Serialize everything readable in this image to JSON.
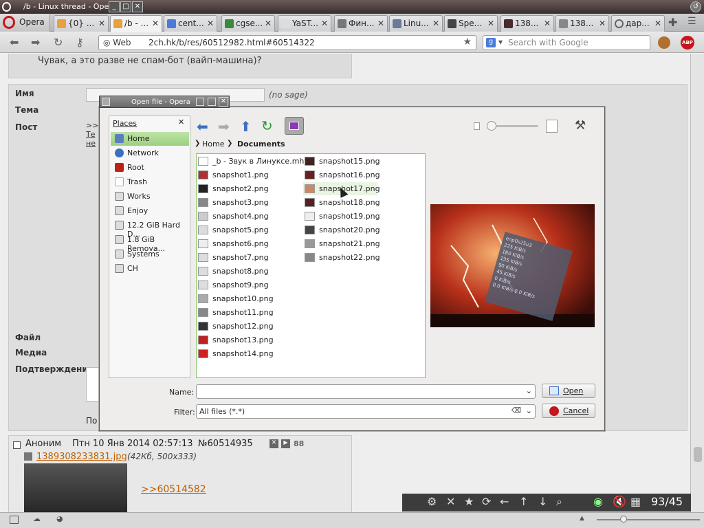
{
  "window": {
    "title": "/b - Linux thread - Opera"
  },
  "tabs": [
    {
      "label": "Opera"
    },
    {
      "label": "{0} ..."
    },
    {
      "label": "/b - ..."
    },
    {
      "label": "cent..."
    },
    {
      "label": "cgse..."
    },
    {
      "label": "YaST..."
    },
    {
      "label": "Фин..."
    },
    {
      "label": "Linu..."
    },
    {
      "label": "Spe..."
    },
    {
      "label": "138..."
    },
    {
      "label": "138..."
    },
    {
      "label": "дар..."
    }
  ],
  "nav": {
    "web_label": "Web",
    "url": "2ch.hk/b/res/60512982.html#60514322",
    "search_placeholder": "Search with Google",
    "abp": "ABP"
  },
  "page": {
    "quote_text": "Чувак, а это разве не спам-бот (вайп-машина)?",
    "form": {
      "name_label": "Имя",
      "nosage": "(no sage)",
      "subject_label": "Тема",
      "post_label": "Пост",
      "file_label": "Файл",
      "media_label": "Медиа",
      "confirm_label": "Подтверждение",
      "post_prefix": ">>",
      "post_fragment1": "Те",
      "post_fragment2": "не",
      "po_label": "По"
    },
    "reply": {
      "author": "Аноним",
      "date": "Птн 10 Янв 2014 02:57:13",
      "number": "№60514935",
      "count": "88",
      "file_link": "1389308233831.jpg",
      "file_meta": "(42Кб, 500x333)",
      "ref_link": ">>60514582"
    }
  },
  "image_toolbar": {
    "counter": "93/45"
  },
  "dialog": {
    "title": "Open file - Opera",
    "places_title": "Places",
    "places": [
      {
        "label": "Home",
        "icon": "home-icon"
      },
      {
        "label": "Network",
        "icon": "network-icon"
      },
      {
        "label": "Root",
        "icon": "root-icon"
      },
      {
        "label": "Trash",
        "icon": "trash-icon"
      },
      {
        "label": "Works",
        "icon": "drive-icon"
      },
      {
        "label": "Enjoy",
        "icon": "drive-icon"
      },
      {
        "label": "12.2 GiB Hard D...",
        "icon": "harddisk-icon"
      },
      {
        "label": "1.8 GiB Remova...",
        "icon": "removable-icon"
      },
      {
        "label": "Systems",
        "icon": "drive-icon"
      },
      {
        "label": "CH",
        "icon": "drive-icon"
      }
    ],
    "breadcrumb": [
      "Home",
      "Documents"
    ],
    "files_col1": [
      "_b - Звук в Линуксе.mht",
      "snapshot1.png",
      "snapshot2.png",
      "snapshot3.png",
      "snapshot4.png",
      "snapshot5.png",
      "snapshot6.png",
      "snapshot7.png",
      "snapshot8.png",
      "snapshot9.png",
      "snapshot10.png",
      "snapshot11.png",
      "snapshot12.png",
      "snapshot13.png",
      "snapshot14.png"
    ],
    "files_col2": [
      "snapshot15.png",
      "snapshot16.png",
      "snapshot17.png",
      "snapshot18.png",
      "snapshot19.png",
      "snapshot20.png",
      "snapshot21.png",
      "snapshot22.png"
    ],
    "name_label": "Name:",
    "name_value": "",
    "filter_label": "Filter:",
    "filter_value": "All files (*.*)",
    "open_label": "Open",
    "cancel_label": "Cancel",
    "preview_labels": {
      "iface": "enp0s25u3",
      "r1": "225 KiB/s",
      "r2": "180 KiB/s",
      "r3": "135 KiB/s",
      "r4": "90 KiB/s",
      "r5": "45 KiB/s",
      "r6": "0 KiB/s",
      "r7": "0.0 KiB/s",
      "r8": "0.0 KiB/s"
    }
  },
  "colors": {
    "accent_green": "#8cc56e",
    "selected_place": "#9cd07e",
    "link": "#c06000"
  }
}
